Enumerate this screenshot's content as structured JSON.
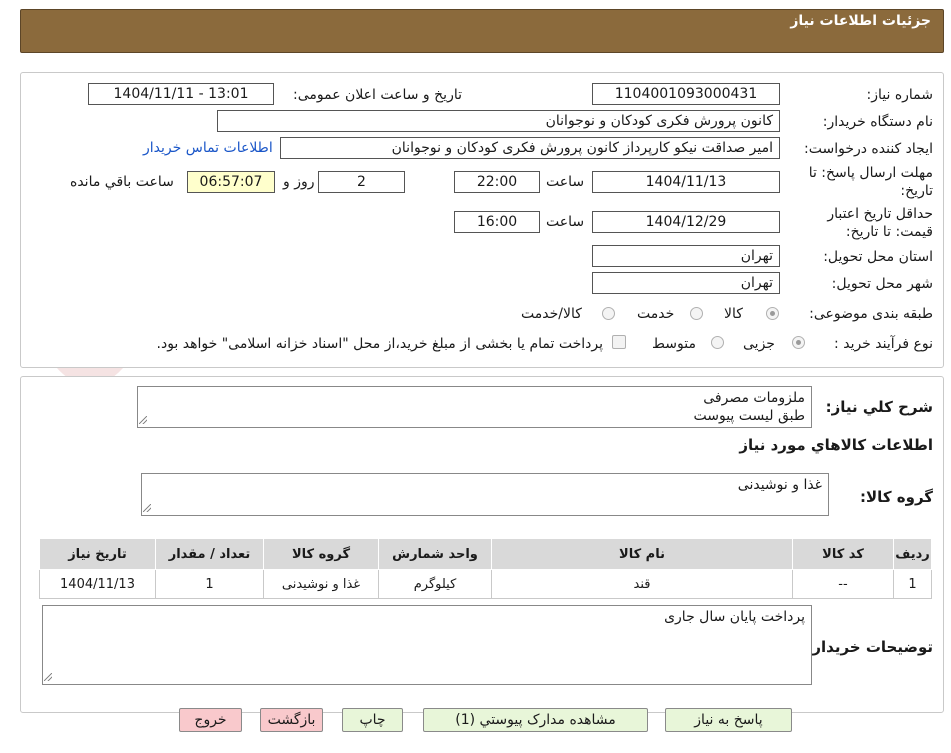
{
  "header": {
    "title": "جزئیات اطلاعات نیاز"
  },
  "form": {
    "need_number_label": "شماره نیاز:",
    "need_number": "1104001093000431",
    "announce_label": "تاریخ و ساعت اعلان عمومی:",
    "announce_value": "1404/11/11 - 13:01",
    "buyer_org_label": "نام دستگاه خریدار:",
    "buyer_org": "کانون پرورش فکری کودکان و نوجوانان",
    "creator_label": "ایجاد کننده درخواست:",
    "creator": "امیر صداقت نیکو کارپرداز کانون پرورش فکری کودکان و نوجوانان",
    "contact_link": "اطلاعات تماس خریدار",
    "deadline_label_1": "مهلت ارسال پاسخ: تا",
    "deadline_label_2": "تاریخ:",
    "deadline_date": "1404/11/13",
    "hour_label": "ساعت",
    "deadline_time": "22:00",
    "days_value": "2",
    "days_label": "روز و",
    "remaining_time": "06:57:07",
    "remaining_label": "ساعت باقي مانده",
    "validity_label_1": "حداقل تاریخ اعتبار",
    "validity_label_2": "قیمت: تا تاریخ:",
    "validity_date": "1404/12/29",
    "validity_hour_label": "ساعت",
    "validity_time": "16:00",
    "province_label": "استان محل تحویل:",
    "province": "تهران",
    "city_label": "شهر محل تحویل:",
    "city": "تهران",
    "category_label": "طبقه بندی موضوعی:",
    "category_options": [
      "کالا",
      "خدمت",
      "کالا/خدمت"
    ],
    "process_label": "نوع فرآیند خرید :",
    "process_options": [
      "جزیی",
      "متوسط"
    ],
    "payment_note": "پرداخت تمام یا بخشی از مبلغ خرید،از محل \"اسناد خزانه اسلامی\" خواهد بود."
  },
  "general": {
    "description_label": "شرح کلي نياز:",
    "description": "ملزومات مصرفی\nطبق لیست پیوست",
    "goods_info_title": "اطلاعات کالاهاي مورد نياز",
    "goods_group_label": "گروه کالا:",
    "goods_group": "غذا و نوشیدنی"
  },
  "table": {
    "headers": [
      "ردیف",
      "کد کالا",
      "نام کالا",
      "واحد شمارش",
      "گروه کالا",
      "تعداد / مقدار",
      "تاریخ نیاز"
    ],
    "rows": [
      [
        "1",
        "--",
        "قند",
        "کیلوگرم",
        "غذا و نوشیدنی",
        "1",
        "1404/11/13"
      ]
    ]
  },
  "buyer_notes": {
    "label": "توضیحات خریدار:",
    "text": "پرداخت پایان سال جاری"
  },
  "buttons": {
    "reply": "پاسخ به نیاز",
    "attachments": "مشاهده مدارک پیوستي (1)",
    "print": "چاپ",
    "back": "بازگشت",
    "exit": "خروج"
  },
  "watermark": {
    "text": "AriaTender.neT"
  },
  "colors": {
    "header": "#8b6a3c",
    "link": "#1a56c8",
    "button_green": "#e8f6d9",
    "button_pink": "#f9c9cc"
  }
}
